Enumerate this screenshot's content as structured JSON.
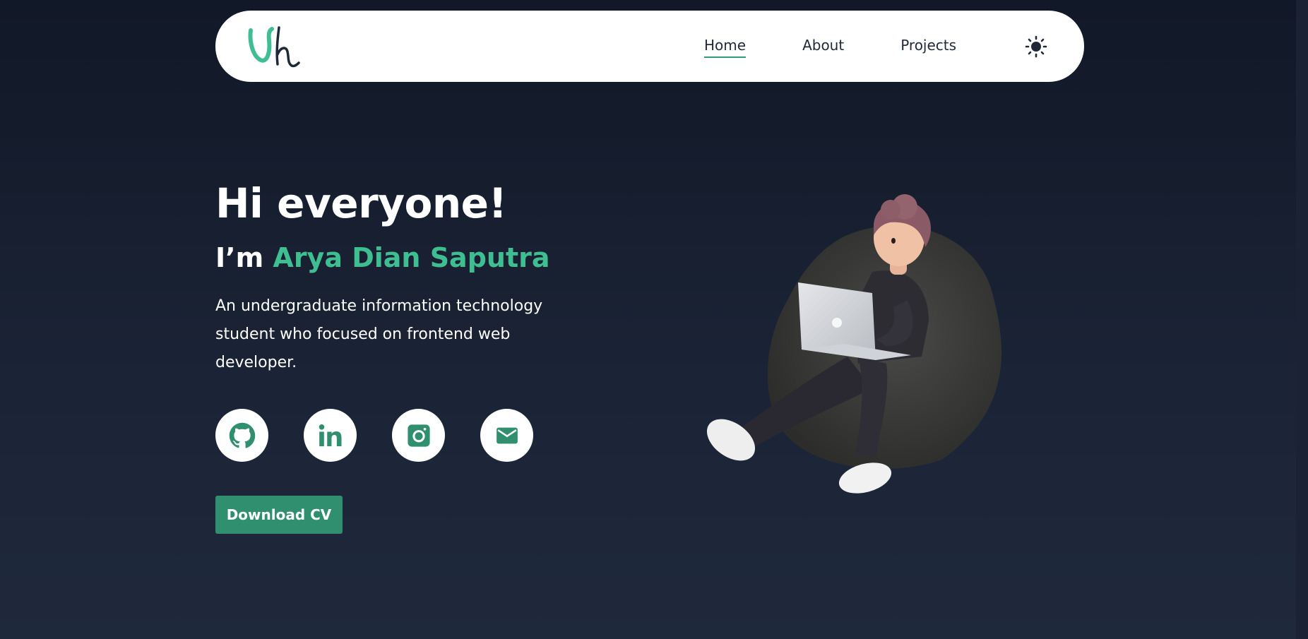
{
  "navbar": {
    "logo_alt": "logo",
    "links": [
      {
        "label": "Home",
        "active": true
      },
      {
        "label": "About",
        "active": false
      },
      {
        "label": "Projects",
        "active": false
      }
    ],
    "theme_icon": "sun-icon"
  },
  "hero": {
    "greeting": "Hi everyone!",
    "intro_prefix": "I’m ",
    "name": "Arya Dian Saputra",
    "description": "An undergraduate information technology student who focused on frontend web developer.",
    "socials": [
      {
        "icon": "github-icon"
      },
      {
        "icon": "linkedin-icon"
      },
      {
        "icon": "instagram-icon"
      },
      {
        "icon": "mail-icon"
      }
    ],
    "download_label": "Download CV",
    "illustration_icon": "developer-on-beanbag-illustration"
  },
  "colors": {
    "accent": "#3fbf91",
    "button": "#2f8f6e",
    "background_top": "#111827",
    "background_bottom": "#1e293b",
    "nav_text": "#1f2937"
  }
}
